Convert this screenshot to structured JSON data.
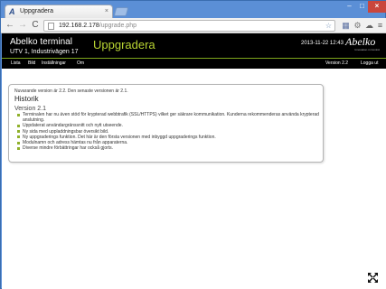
{
  "browser": {
    "tab_title": "Uppgradera",
    "tab_favicon": "A",
    "tab_close": "×",
    "url_host": "192.168.2.178",
    "url_path": "/upgrade.php",
    "window_controls": {
      "minimize": "–",
      "maximize": "□",
      "close": "×"
    },
    "nav": {
      "back": "←",
      "forward": "→",
      "reload": "C"
    },
    "icons": [
      "translate-icon",
      "star-icon",
      "settings-icon",
      "cloud-icon",
      "menu-icon"
    ]
  },
  "header": {
    "app_name": "Abelko terminal",
    "location": "UTV 1, Industrivägen 17",
    "page_title": "Uppgradera",
    "datetime": "2013-11-22 12:43",
    "logo": "Abelko",
    "logo_sub": "Innovation in Control"
  },
  "menu": {
    "items": [
      "Lista",
      "Bild",
      "Inställningar",
      "Om"
    ],
    "version": "Version 2.2",
    "logout": "Logga ut"
  },
  "content": {
    "current_version_text": "Nuvarande version är 2.2. Den senaste versionen är 2.1.",
    "history_heading": "Historik",
    "version_heading": "Version 2.1",
    "changes": [
      "Terminalen har nu även stöd för krypterad webbtrafik (SSL/HTTPS) vilket ger säkrare kommunikation. Kunderna rekommenderas använda krypterad anslutning.",
      "Uppdaterat användargränssnitt och nytt utseende.",
      "Ny sida med uppladdningsbar översikt bild.",
      "Ny uppgraderings funktion. Det här är den första versionen med inbyggd uppgraderings funktion.",
      "Modulnamn och adress hämtas nu från apparaterna.",
      "Diverse mindre förbättringar har också gjorts."
    ]
  },
  "colors": {
    "accent_green": "#b9d532",
    "header_bg": "#000000",
    "bullet_green": "#8fb02a",
    "chrome_blue": "#5b8fd6"
  }
}
